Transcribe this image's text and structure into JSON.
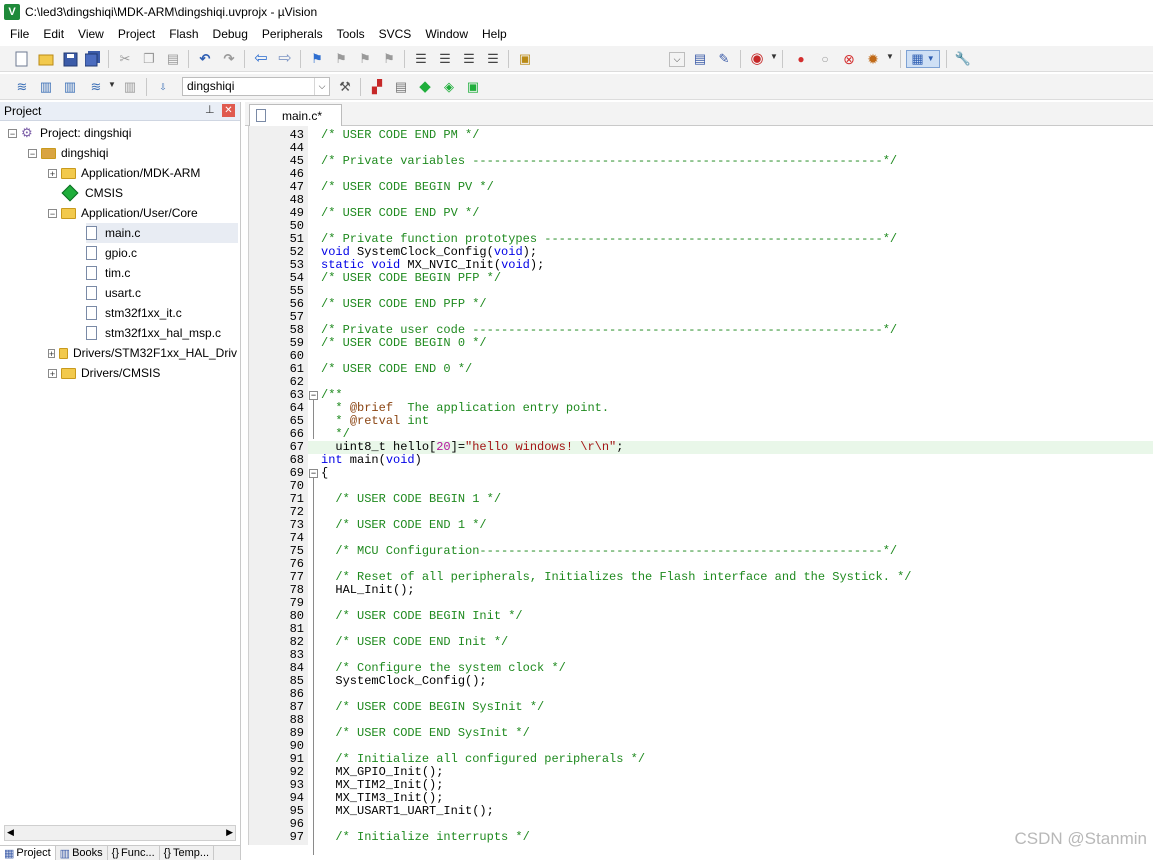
{
  "window": {
    "title": "C:\\led3\\dingshiqi\\MDK-ARM\\dingshiqi.uvprojx - µVision",
    "icon_glyph": "V"
  },
  "menu": [
    "File",
    "Edit",
    "View",
    "Project",
    "Flash",
    "Debug",
    "Peripherals",
    "Tools",
    "SVCS",
    "Window",
    "Help"
  ],
  "toolbar2": {
    "target_value": "dingshiqi"
  },
  "project_panel": {
    "title": "Project",
    "root": "Project: dingshiqi",
    "target": "dingshiqi",
    "groups": [
      {
        "label": "Application/MDK-ARM",
        "kind": "folder",
        "expander": "+"
      },
      {
        "label": "CMSIS",
        "kind": "diamond"
      },
      {
        "label": "Application/User/Core",
        "kind": "folder",
        "expander": "−"
      },
      {
        "label": "main.c",
        "kind": "file"
      },
      {
        "label": "gpio.c",
        "kind": "file"
      },
      {
        "label": "tim.c",
        "kind": "file"
      },
      {
        "label": "usart.c",
        "kind": "file"
      },
      {
        "label": "stm32f1xx_it.c",
        "kind": "file"
      },
      {
        "label": "stm32f1xx_hal_msp.c",
        "kind": "file"
      },
      {
        "label": "Drivers/STM32F1xx_HAL_Driv",
        "kind": "folder",
        "expander": "+"
      },
      {
        "label": "Drivers/CMSIS",
        "kind": "folder",
        "expander": "+"
      }
    ],
    "tabs": [
      "Project",
      "Books",
      "Func...",
      "Temp..."
    ]
  },
  "editor": {
    "tab_label": "main.c*",
    "lines": [
      {
        "n": "43",
        "t": "/* USER CODE END PM */"
      },
      {
        "n": "44",
        "t": ""
      },
      {
        "n": "45",
        "t": "/* Private variables ---------------------------------------------------------*/"
      },
      {
        "n": "46",
        "t": ""
      },
      {
        "n": "47",
        "t": "/* USER CODE BEGIN PV */"
      },
      {
        "n": "48",
        "t": ""
      },
      {
        "n": "49",
        "t": "/* USER CODE END PV */"
      },
      {
        "n": "50",
        "t": ""
      },
      {
        "n": "51",
        "t": "/* Private function prototypes -----------------------------------------------*/"
      },
      {
        "n": "52",
        "t": "void SystemClock_Config(void);"
      },
      {
        "n": "53",
        "t": "static void MX_NVIC_Init(void);"
      },
      {
        "n": "54",
        "t": "/* USER CODE BEGIN PFP */"
      },
      {
        "n": "55",
        "t": ""
      },
      {
        "n": "56",
        "t": "/* USER CODE END PFP */"
      },
      {
        "n": "57",
        "t": ""
      },
      {
        "n": "58",
        "t": "/* Private user code ---------------------------------------------------------*/"
      },
      {
        "n": "59",
        "t": "/* USER CODE BEGIN 0 */"
      },
      {
        "n": "60",
        "t": ""
      },
      {
        "n": "61",
        "t": "/* USER CODE END 0 */"
      },
      {
        "n": "62",
        "t": ""
      },
      {
        "n": "63",
        "t": "/**"
      },
      {
        "n": "64",
        "t": "  * @brief  The application entry point."
      },
      {
        "n": "65",
        "t": "  * @retval int"
      },
      {
        "n": "66",
        "t": "  */"
      },
      {
        "n": "67",
        "t": "  uint8_t hello[20]=\"hello windows! \\r\\n\";"
      },
      {
        "n": "68",
        "t": "int main(void)"
      },
      {
        "n": "69",
        "t": "{"
      },
      {
        "n": "70",
        "t": ""
      },
      {
        "n": "71",
        "t": "  /* USER CODE BEGIN 1 */"
      },
      {
        "n": "72",
        "t": ""
      },
      {
        "n": "73",
        "t": "  /* USER CODE END 1 */"
      },
      {
        "n": "74",
        "t": ""
      },
      {
        "n": "75",
        "t": "  /* MCU Configuration--------------------------------------------------------*/"
      },
      {
        "n": "76",
        "t": ""
      },
      {
        "n": "77",
        "t": "  /* Reset of all peripherals, Initializes the Flash interface and the Systick. */"
      },
      {
        "n": "78",
        "t": "  HAL_Init();"
      },
      {
        "n": "79",
        "t": ""
      },
      {
        "n": "80",
        "t": "  /* USER CODE BEGIN Init */"
      },
      {
        "n": "81",
        "t": ""
      },
      {
        "n": "82",
        "t": "  /* USER CODE END Init */"
      },
      {
        "n": "83",
        "t": ""
      },
      {
        "n": "84",
        "t": "  /* Configure the system clock */"
      },
      {
        "n": "85",
        "t": "  SystemClock_Config();"
      },
      {
        "n": "86",
        "t": ""
      },
      {
        "n": "87",
        "t": "  /* USER CODE BEGIN SysInit */"
      },
      {
        "n": "88",
        "t": ""
      },
      {
        "n": "89",
        "t": "  /* USER CODE END SysInit */"
      },
      {
        "n": "90",
        "t": ""
      },
      {
        "n": "91",
        "t": "  /* Initialize all configured peripherals */"
      },
      {
        "n": "92",
        "t": "  MX_GPIO_Init();"
      },
      {
        "n": "93",
        "t": "  MX_TIM2_Init();"
      },
      {
        "n": "94",
        "t": "  MX_TIM3_Init();"
      },
      {
        "n": "95",
        "t": "  MX_USART1_UART_Init();"
      },
      {
        "n": "96",
        "t": ""
      },
      {
        "n": "97",
        "t": "  /* Initialize interrupts */"
      }
    ]
  },
  "watermark": "CSDN @Stanmin",
  "colors": {
    "comment": "#1f8a1f",
    "keyword": "#0000e6",
    "string": "#a31515",
    "number": "#b5179e",
    "highlight_line": "#e9f7e9"
  }
}
